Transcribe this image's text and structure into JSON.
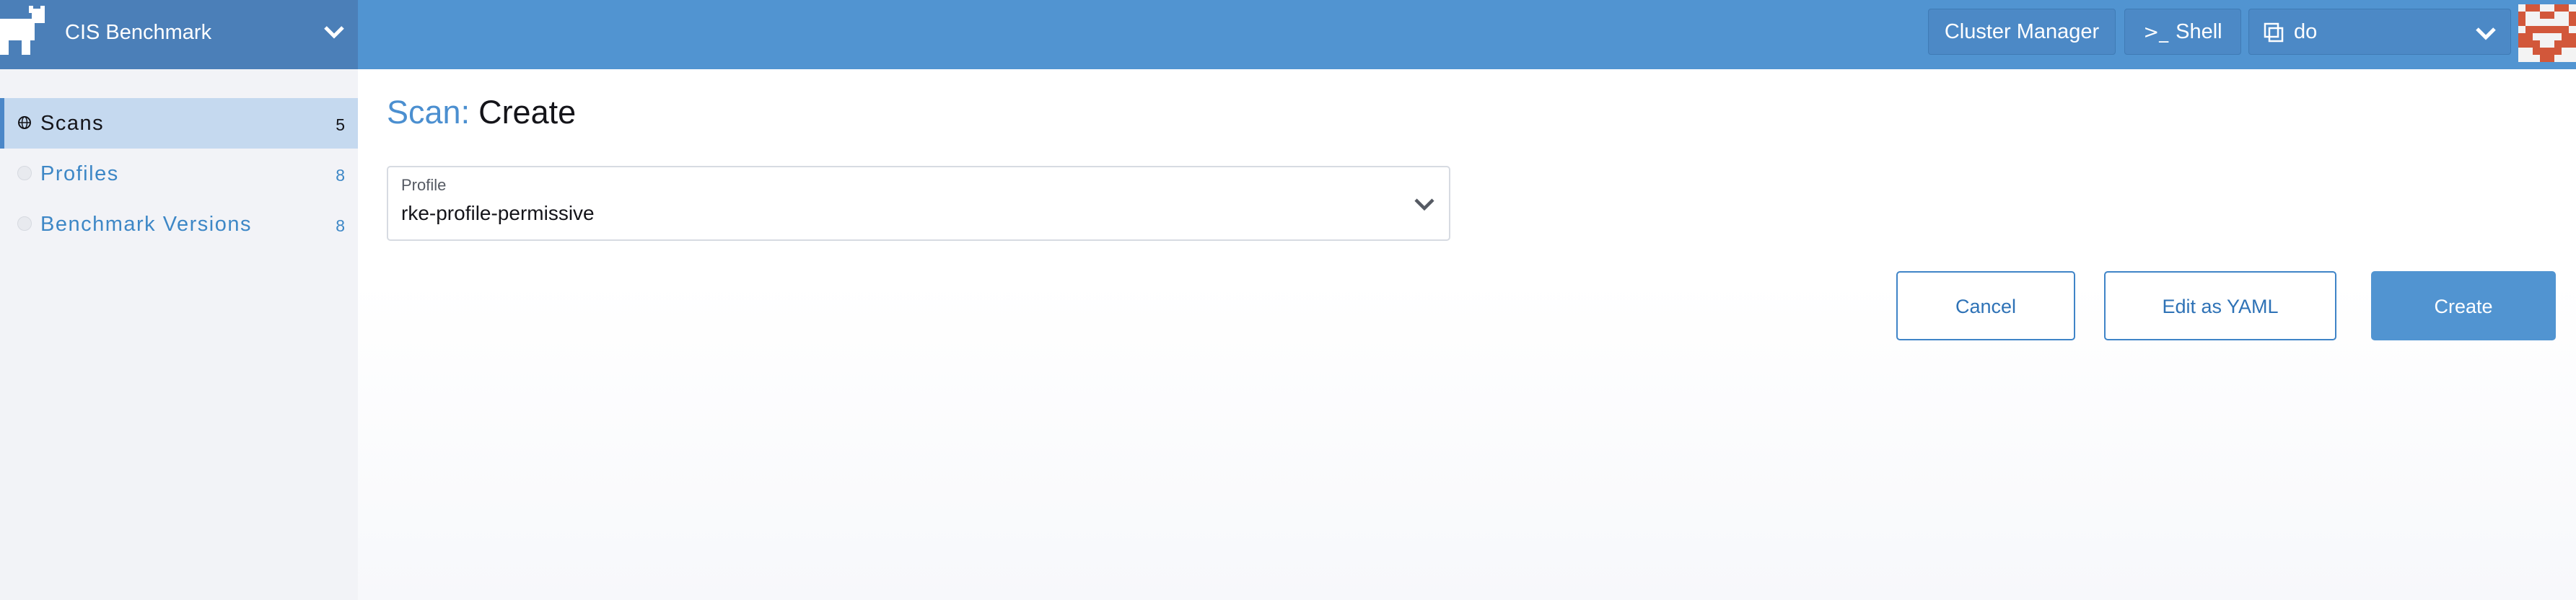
{
  "header": {
    "product_name": "CIS Benchmark",
    "cluster_manager_label": "Cluster Manager",
    "shell_label": "Shell",
    "namespace_value": "do",
    "colors": {
      "bar": "#5194d1",
      "product": "#4b7fb8"
    }
  },
  "sidebar": {
    "items": [
      {
        "label": "Scans",
        "count": "5",
        "active": true
      },
      {
        "label": "Profiles",
        "count": "8",
        "active": false
      },
      {
        "label": "Benchmark Versions",
        "count": "8",
        "active": false
      }
    ]
  },
  "main": {
    "title_prefix": "Scan:",
    "title_rest": "Create",
    "profile": {
      "label": "Profile",
      "value": "rke-profile-permissive"
    },
    "buttons": {
      "cancel": "Cancel",
      "edit_yaml": "Edit as YAML",
      "create": "Create"
    }
  },
  "icons": [
    "cow-logo-icon",
    "chevron-down-icon",
    "terminal-icon",
    "namespace-icon",
    "avatar",
    "globe-icon",
    "circle-icon"
  ]
}
